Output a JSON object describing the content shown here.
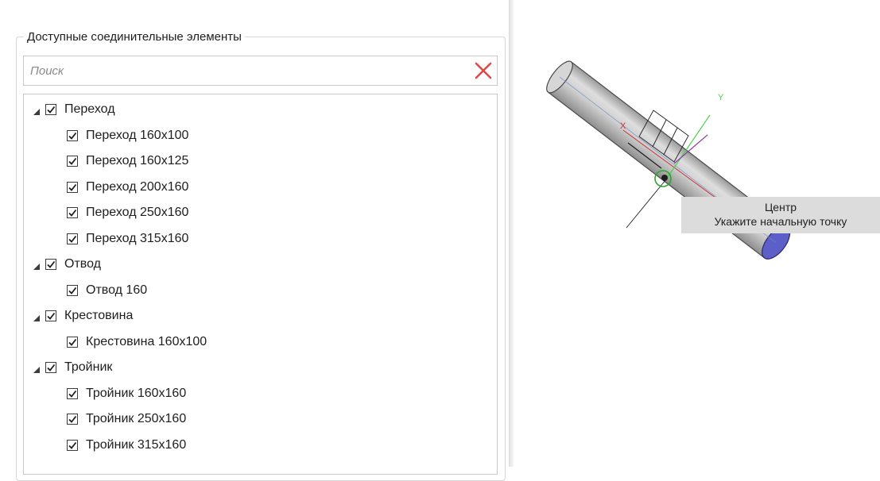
{
  "panel": {
    "group_title": "Доступные соединительные элементы",
    "search": {
      "placeholder": "Поиск",
      "value": ""
    }
  },
  "tree": [
    {
      "label": "Переход",
      "checked": true,
      "expanded": true,
      "children": [
        {
          "label": "Переход 160x100",
          "checked": true
        },
        {
          "label": "Переход 160x125",
          "checked": true
        },
        {
          "label": "Переход 200x160",
          "checked": true
        },
        {
          "label": "Переход 250x160",
          "checked": true
        },
        {
          "label": "Переход 315x160",
          "checked": true
        }
      ]
    },
    {
      "label": "Отвод",
      "checked": true,
      "expanded": true,
      "children": [
        {
          "label": "Отвод 160",
          "checked": true
        }
      ]
    },
    {
      "label": "Крестовина",
      "checked": true,
      "expanded": true,
      "children": [
        {
          "label": "Крестовина 160x100",
          "checked": true
        }
      ]
    },
    {
      "label": "Тройник",
      "checked": true,
      "expanded": true,
      "children": [
        {
          "label": "Тройник 160x160",
          "checked": true
        },
        {
          "label": "Тройник 250x160",
          "checked": true
        },
        {
          "label": "Тройник 315x160",
          "checked": true
        }
      ]
    }
  ],
  "viewport": {
    "axis_x_label": "X",
    "axis_y_label": "Y",
    "tooltip": {
      "title": "Центр",
      "prompt": "Укажите начальную точку"
    }
  },
  "colors": {
    "clear_icon": "#e04848",
    "pipe_body": "#c4c4c4",
    "pipe_end": "#5e5ec8",
    "axis_x": "#d03030",
    "axis_y": "#4cd04c",
    "axis_z": "#8a3aa0"
  }
}
